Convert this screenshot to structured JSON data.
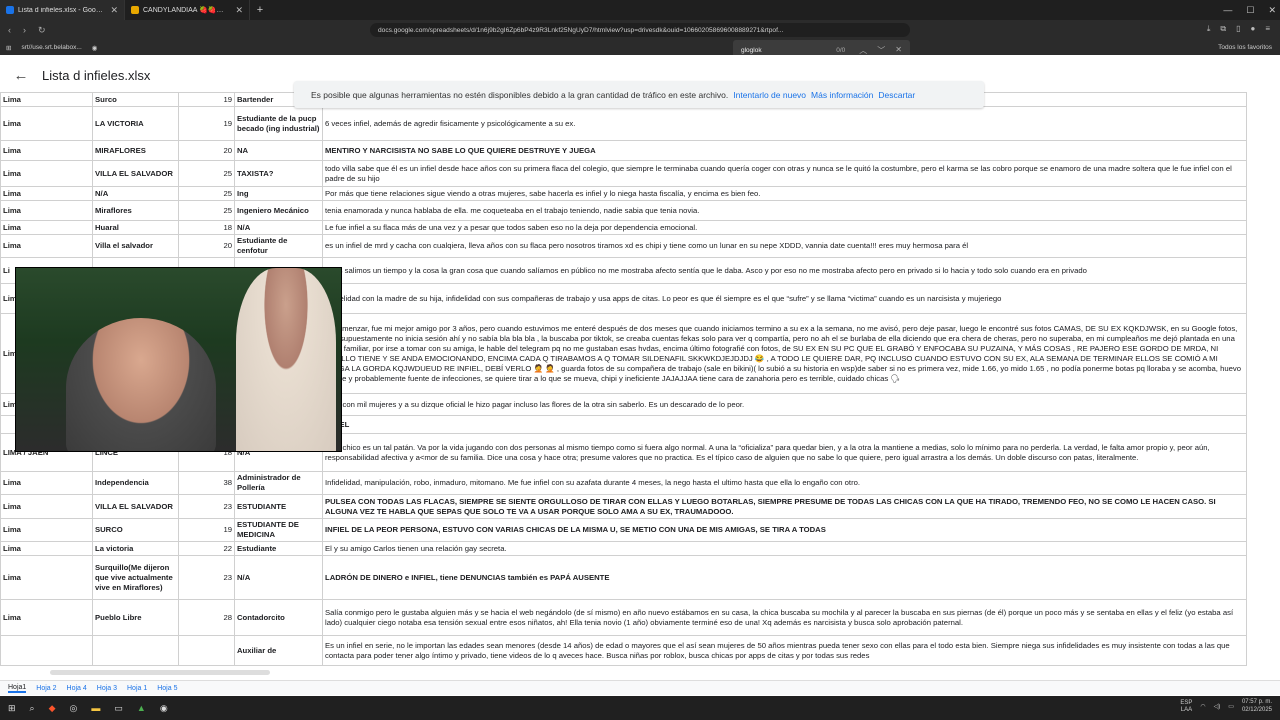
{
  "browser": {
    "tabs": [
      {
        "title": "Lista d infieles.xlsx - Google Drive",
        "active": true
      },
      {
        "title": "CANDYLANDIAA 🍓🍓🍓🍓 - Google",
        "active": false
      }
    ],
    "url": "docs.google.com/spreadsheets/d/1n6j9b2gI6Zp6bP4z9R3Lnkf25NgUyD7/htmlview?usp=drivesdk&ouid=106602058696008889271&rtpof...",
    "bookmark": "srt//use.srt.belabox...",
    "favorites": "Todos los favoritos",
    "find_query": "gloglok",
    "find_count": "0/0"
  },
  "header": {
    "title": "Lista d infieles.xlsx"
  },
  "banner": {
    "message": "Es posible que algunas herramientas no estén disponibles debido a la gran cantidad de tráfico en este archivo.",
    "retry": "Intentarlo de nuevo",
    "more": "Más información",
    "dismiss": "Descartar"
  },
  "rows": [
    {
      "city": "Lima",
      "district": "Surco",
      "age": "19",
      "occupation": "Bartender",
      "desc": "",
      "bold": false,
      "tail": "",
      "occ_cut": true
    },
    {
      "city": "Lima",
      "district": "LA VICTORIA",
      "age": "19",
      "occupation": "Estudiante de la pucp becado (ing industrial)",
      "desc": "6 veces infiel, además de agredir fisicamente y psicológicamente a su ex.",
      "bold": false,
      "tail": ""
    },
    {
      "city": "Lima",
      "district": "MIRAFLORES",
      "age": "20",
      "occupation": "NA",
      "desc": "MENTIRO Y NARCISISTA NO SABE LO QUE QUIERE DESTRUYE Y JUEGA",
      "bold": true,
      "tail": ""
    },
    {
      "city": "Lima",
      "district": "VILLA EL SALVADOR",
      "age": "25",
      "occupation": "TAXISTA?",
      "desc": "todo villa sabe que él es un infiel desde hace años con su primera flaca del colegio, que siempre le terminaba cuando quería coger con otras y nunca se le quitó la costumbre, pero el karma se las cobro porque se enamoro de una madre soltera que le fue infiel con el padre de su hijo",
      "bold": false,
      "tail": ""
    },
    {
      "city": "Lima",
      "district": "N/A",
      "age": "25",
      "occupation": "Ing",
      "desc": "Por más que tiene relaciones sigue viendo a otras mujeres, sabe hacerla es infiel y lo niega hasta fiscalía, y encima es bien feo.",
      "bold": false,
      "tail": ""
    },
    {
      "city": "Lima",
      "district": "Miraflores",
      "age": "25",
      "occupation": "Ingeniero Mecánico",
      "desc": "tenia enamorada y nunca hablaba de ella. me coqueteaba en el trabajo teniendo, nadie sabia que tenia novia.",
      "bold": false,
      "tail": ""
    },
    {
      "city": "Lima",
      "district": "Huaral",
      "age": "18",
      "occupation": "N/A",
      "desc": "Le fue infiel a su flaca más de una vez y a pesar que todos saben eso no la deja por dependencia emocional.",
      "bold": false,
      "tail": ""
    },
    {
      "city": "Lima",
      "district": "Villa el salvador",
      "age": "20",
      "occupation": "Estudiante de cenfotur",
      "desc": "es un infiel de mrd y cacha con cualqiera, lleva años con su flaca pero nosotros tiramos xd es chipi y tiene como un lunar en su nepe XDDD, vannia date cuenta!!! eres muy hermosa para él",
      "bold": false,
      "tail": ""
    },
    {
      "city": "Li",
      "district": "",
      "age": "",
      "occupation": "",
      "desc": "Pues salimos un tiempo y la cosa la gran cosa que cuando salíamos en público no me mostraba afecto sentía que le daba. Asco y por eso no me mostraba afecto pero en privado si lo hacia y todo solo cuando era en privado",
      "bold": false,
      "tail": ""
    },
    {
      "city": "Lim",
      "district": "",
      "age": "",
      "occupation": "",
      "desc": "Infidelidad con la madre de su hija, infidelidad con sus compañeras de trabajo y usa apps de citas. Lo peor es que él siempre es el que “sufre” y se llama “victima” cuando es un narcisista y mujeriego",
      "bold": false,
      "tail": "L"
    },
    {
      "city": "Lim",
      "district": "",
      "age": "",
      "occupation": "",
      "desc": "Al comenzar, fue mi mejor amigo por 3 años, pero cuando estuvimos me enteré después de dos meses que cuando iniciamos termino a su ex a la semana, no me avisó, pero deje pasar, luego le encontré sus fotos CAMAS, DE SU EX KQKDJWSK, en su Google fotos, que supuestamente no inicia sesión ahí y no sabía bla bla bla , la buscaba por tiktok, se creaba cuentas fekas solo para ver q compartía, pero no ah el se burlaba de ella diciendo que era chera de cheras, pero no superaba, en mi cumpleaños me dejó plantada en una cena familiar, por irse a tomar con su amiga, le hable del telegram pq no me gustaban esas hvdas, encima último fotografié con fotos, de SU EX EN SU PC QUE EL GRABÓ Y ENFOCABA SU PUZAINA, Y MÁS COSAS , RE PAJERO ESE GORDO DE MRDA, NI CUELLO TIENE Y SE ANDA EMOCIONANDO, ENCIMA CADA Q TIRABAMOS A Q TOMAR SILDENAFIL SKKWKDJEJDJDJ 😂 , A TODO LE QUIERE DAR, PQ INCLUSO CUANDO ESTUVO CON SU EX, ALA SEMANA DE TERMINAR ELLOS SE COMIÓ A MI AMIGA LA GORDA KQJWDUEUD RE INFIEL, DEBÍ VERLO 🤦 🤦 , guarda fotos de su compañera de trabajo (sale en bikini)( lo subió a su historia en wsp)de saber si no es primera vez, mide 1.66, yo mido 1.65 , no podía ponerme botas pq lloraba y se acomba, huevo alegre y probablemente fuente de infecciones, se quiere tirar a lo que se mueva, chipi y ineficiente JAJAJJAA tiene cara de zanahoria pero es terrible, cuidado chicas 🗣",
      "bold": false,
      "tail": ""
    },
    {
      "city": "Lim",
      "district": "",
      "age": "",
      "occupation": "",
      "desc": "Sale con mil mujeres y a su dizque oficial le hizo pagar incluso las flores de la otra sin saberlo. Es un descarado de lo peor.",
      "bold": false,
      "tail": ""
    },
    {
      "city": "",
      "district": "",
      "age": "",
      "occupation": "",
      "desc": "INFIEL",
      "bold": true,
      "tail": ""
    },
    {
      "city": "LIMA / JAÉN",
      "district": "LINCE",
      "age": "18",
      "occupation": "N/A",
      "desc": "Este chico es un tal patán. Va por la vida jugando con dos personas al mismo tiempo como si fuera algo normal. A una la “oficializa” para quedar bien, y a la otra la mantiene a medias, solo lo mínimo para no perderla. La verdad, le falta amor propio y, peor aún, responsabilidad afectiva y a<mor de su familia. Dice una cosa y hace otra; presume valores que no practica. Es el típico caso de alguien que no sabe lo que quiere, pero igual arrastra a los demás. Un doble discurso con patas, literalmente.",
      "bold": false,
      "tail": ""
    },
    {
      "city": "Lima",
      "district": "Independencia",
      "age": "38",
      "occupation": "Administrador de Pollería",
      "desc": "Infidelidad, manipulación, robo, inmaduro, mitomano. Me fue infiel con su azafata durante 4 meses, la nego hasta el ultimo hasta que ella lo engaño con otro.",
      "bold": false,
      "tail": ""
    },
    {
      "city": "Lima",
      "district": "VILLA EL SALVADOR",
      "age": "23",
      "occupation": "ESTUDIANTE",
      "desc": "PULSEA CON TODAS LAS FLACAS, SIEMPRE SE SIENTE ORGULLOSO DE TIRAR CON ELLAS Y LUEGO BOTARLAS, SIEMPRE PRESUME DE TODAS LAS CHICAS CON LA QUE HA TIRADO, TREMENDO FEO, NO SE COMO LE HACEN CASO. SI ALGUNA VEZ TE HABLA QUE SEPAS QUE SOLO TE VA A USAR PORQUE SOLO AMA A SU EX, TRAUMADOOO.",
      "bold": true,
      "tail": ""
    },
    {
      "city": "Lima",
      "district": "SURCO",
      "age": "19",
      "occupation": "ESTUDIANTE DE MEDICINA",
      "desc": "INFIEL DE LA PEOR PERSONA, ESTUVO CON VARIAS CHICAS DE LA MISMA U, SE METIO CON UNA DE MIS AMIGAS, SE TIRA A TODAS",
      "bold": true,
      "tail": "L"
    },
    {
      "city": "Lima",
      "district": "La victoria",
      "age": "22",
      "occupation": "Estudiante",
      "desc": "El y su amigo Carlos tienen una relación gay secreta.",
      "bold": false,
      "tail": ""
    },
    {
      "city": "Lima",
      "district": "Surquillo(Me dijeron que vive actualmente vive en Miraflores)",
      "age": "23",
      "occupation": "N/A",
      "desc": "LADRÓN DE DINERO e INFIEL, tiene DENUNCIAS también es PAPÁ AUSENTE",
      "bold": true,
      "tail": ""
    },
    {
      "city": "Lima",
      "district": "Pueblo Libre",
      "age": "28",
      "occupation": "Contadorcito",
      "desc": "Salía conmigo pero le gustaba alguien más y se hacia el web negándolo (de sí mismo) en año nuevo estábamos en su casa, la chica buscaba su mochila y al parecer la buscaba en sus piernas (de él) porque un poco más y se sentaba en ellas y el feliz (yo estaba así lado) cualquier ciego notaba esa tensión sexual entre esos niñatos, ah! Ella tenia novio (1 año) obviamente terminé eso de una! Xq además es narcisista y busca solo aprobación paternal.",
      "bold": false,
      "tail": ""
    },
    {
      "city": "",
      "district": "",
      "age": "",
      "occupation": "Auxiliar de",
      "desc": "Es un infiel en serie, no le importan las edades sean menores (desde 14 años) de edad o mayores que el así sean mujeres de 50 años mientras pueda tener sexo con ellas para el todo esta bien. Siempre niega sus infidelidades es muy insistente con todas a las que contacta para poder tener algo íntimo y privado, tiene videos de lo q aveces hace. Busca niñas por roblox, busca chicas por apps de citas y por todas sus redes",
      "bold": false,
      "tail": ""
    }
  ],
  "sheet_tabs": [
    "Hoja1",
    "Hoja 2",
    "Hoja 4",
    "Hoja 3",
    "Hoja 1",
    "Hoja 5"
  ],
  "taskbar": {
    "lang": "ESP",
    "lang2": "LAA",
    "time": "07:57 p. m.",
    "date": "02/12/2025"
  }
}
